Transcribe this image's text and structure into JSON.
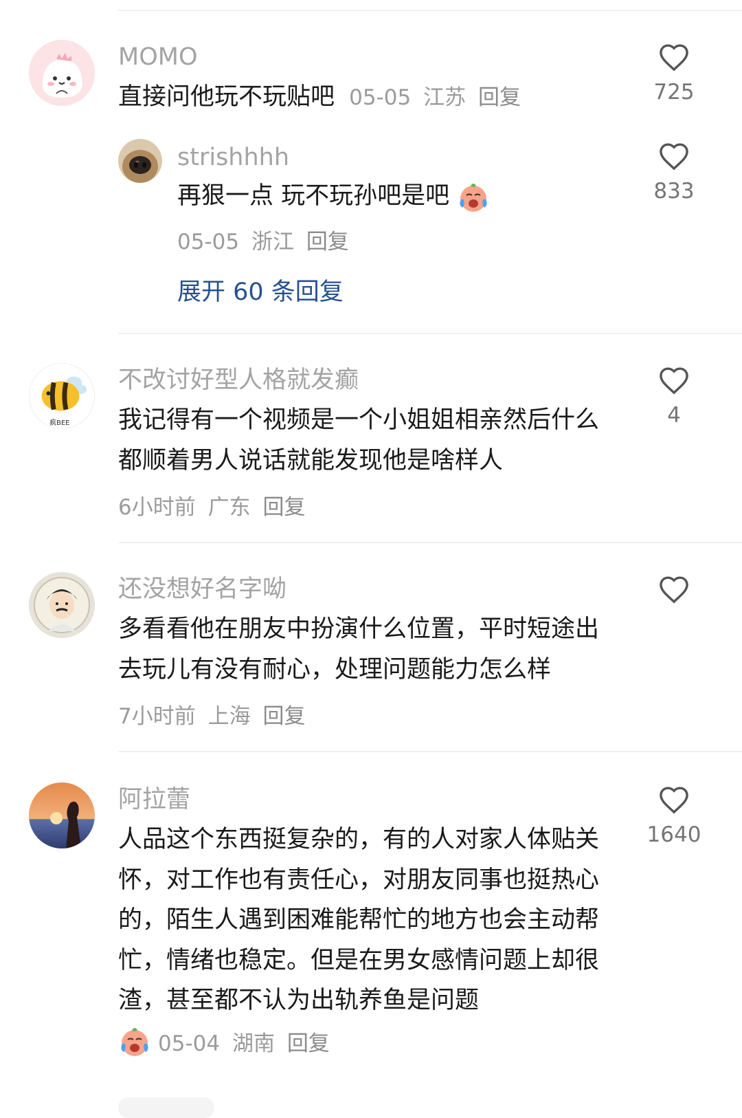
{
  "comments": [
    {
      "username": "MOMO",
      "text": "直接问他玩不玩贴吧",
      "date": "05-05",
      "location": "江苏",
      "reply_label": "回复",
      "likes": "725",
      "avatar_icon": "cartoon-dinosaur-avatar",
      "reply": {
        "username": "strishhhh",
        "text": "再狠一点 玩不玩孙吧是吧",
        "emoji": "crying-laughing-face-emoji",
        "date": "05-05",
        "location": "浙江",
        "reply_label": "回复",
        "likes": "833",
        "avatar_icon": "dog-nose-avatar"
      },
      "expand_label": "展开 60 条回复"
    },
    {
      "username": "不改讨好型人格就发癫",
      "text": "我记得有一个视频是一个小姐姐相亲然后什么都顺着男人说话就能发现他是啥样人",
      "date": "6小时前",
      "location": "广东",
      "reply_label": "回复",
      "likes": "4",
      "avatar_icon": "bee-avatar",
      "avatar_label": "疯BEE"
    },
    {
      "username": "还没想好名字呦",
      "text": "多看看他在朋友中扮演什么位置，平时短途出去玩儿有没有耐心，处理问题能力怎么样",
      "date": "7小时前",
      "location": "上海",
      "reply_label": "回复",
      "likes": "",
      "avatar_icon": "cartoon-man-avatar"
    },
    {
      "username": "阿拉蕾",
      "text": "人品这个东西挺复杂的，有的人对家人体贴关怀，对工作也有责任心，对朋友同事也挺热心的，陌生人遇到困难能帮忙的地方也会主动帮忙，情绪也稳定。但是在男女感情问题上却很渣，甚至都不认为出轨养鱼是问题",
      "emoji": "crying-laughing-face-emoji",
      "date": "05-04",
      "location": "湖南",
      "reply_label": "回复",
      "likes": "1640",
      "avatar_icon": "sunset-silhouette-avatar"
    }
  ],
  "colors": {
    "username": "#a3a3a3",
    "text": "#1a1a1a",
    "meta": "#9b9b9b",
    "expand": "#26518f",
    "divider": "#f1f1f1"
  }
}
